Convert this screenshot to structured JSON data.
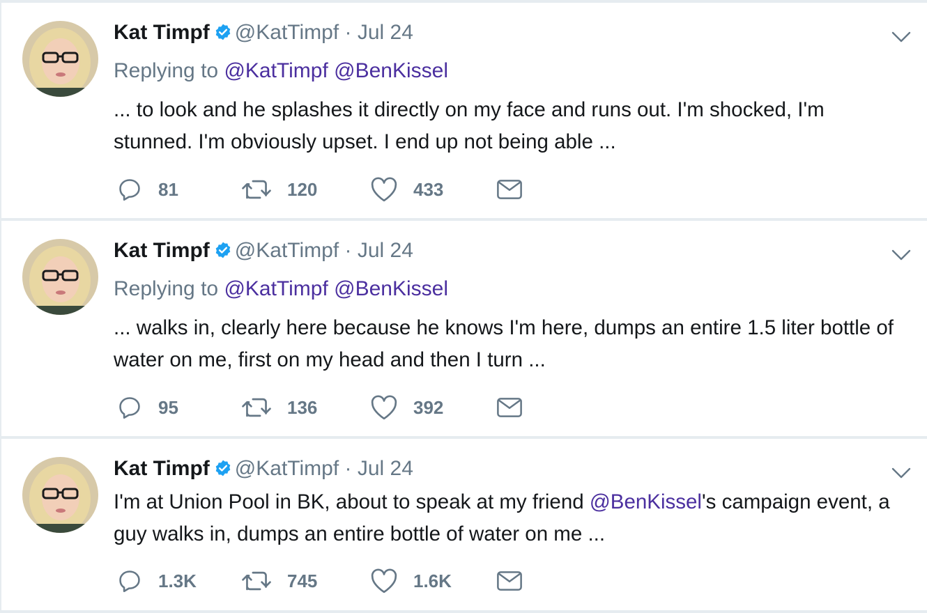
{
  "colors": {
    "page_bg": "#e6ecf0",
    "card_bg": "#ffffff",
    "name": "#14171a",
    "secondary": "#657786",
    "mention": "#4b2f9f",
    "verified": "#1da1f2"
  },
  "tweets": [
    {
      "author": {
        "name": "Kat Timpf",
        "handle": "@KatTimpf",
        "verified": true,
        "avatar_icon": "profile-photo"
      },
      "separator": "·",
      "time": "Jul 24",
      "replying_label": "Replying to",
      "replying_mentions": [
        "@KatTimpf",
        "@BenKissel"
      ],
      "text": {
        "before": "... to look and he splashes it directly on my face and runs out. I'm shocked, I'm stunned. I'm obviously upset. I end up not being able ...",
        "mention": "",
        "after": ""
      },
      "stats": {
        "replies": "81",
        "retweets": "120",
        "likes": "433"
      },
      "icons": [
        "reply-icon",
        "retweet-icon",
        "like-icon",
        "direct-message-icon",
        "chevron-down-icon"
      ]
    },
    {
      "author": {
        "name": "Kat Timpf",
        "handle": "@KatTimpf",
        "verified": true,
        "avatar_icon": "profile-photo"
      },
      "separator": "·",
      "time": "Jul 24",
      "replying_label": "Replying to",
      "replying_mentions": [
        "@KatTimpf",
        "@BenKissel"
      ],
      "text": {
        "before": "... walks in, clearly here because he knows I'm here, dumps an entire 1.5 liter bottle of water on me, first on my head and then I turn ...",
        "mention": "",
        "after": ""
      },
      "stats": {
        "replies": "95",
        "retweets": "136",
        "likes": "392"
      },
      "icons": [
        "reply-icon",
        "retweet-icon",
        "like-icon",
        "direct-message-icon",
        "chevron-down-icon"
      ]
    },
    {
      "author": {
        "name": "Kat Timpf",
        "handle": "@KatTimpf",
        "verified": true,
        "avatar_icon": "profile-photo"
      },
      "separator": "·",
      "time": "Jul 24",
      "replying_label": "",
      "replying_mentions": [],
      "text": {
        "before": "I'm at Union Pool in BK, about to speak at my friend ",
        "mention": "@BenKissel",
        "after": "'s campaign event, a guy walks in, dumps an entire bottle of water on me ..."
      },
      "stats": {
        "replies": "1.3K",
        "retweets": "745",
        "likes": "1.6K"
      },
      "icons": [
        "reply-icon",
        "retweet-icon",
        "like-icon",
        "direct-message-icon",
        "chevron-down-icon"
      ]
    }
  ]
}
